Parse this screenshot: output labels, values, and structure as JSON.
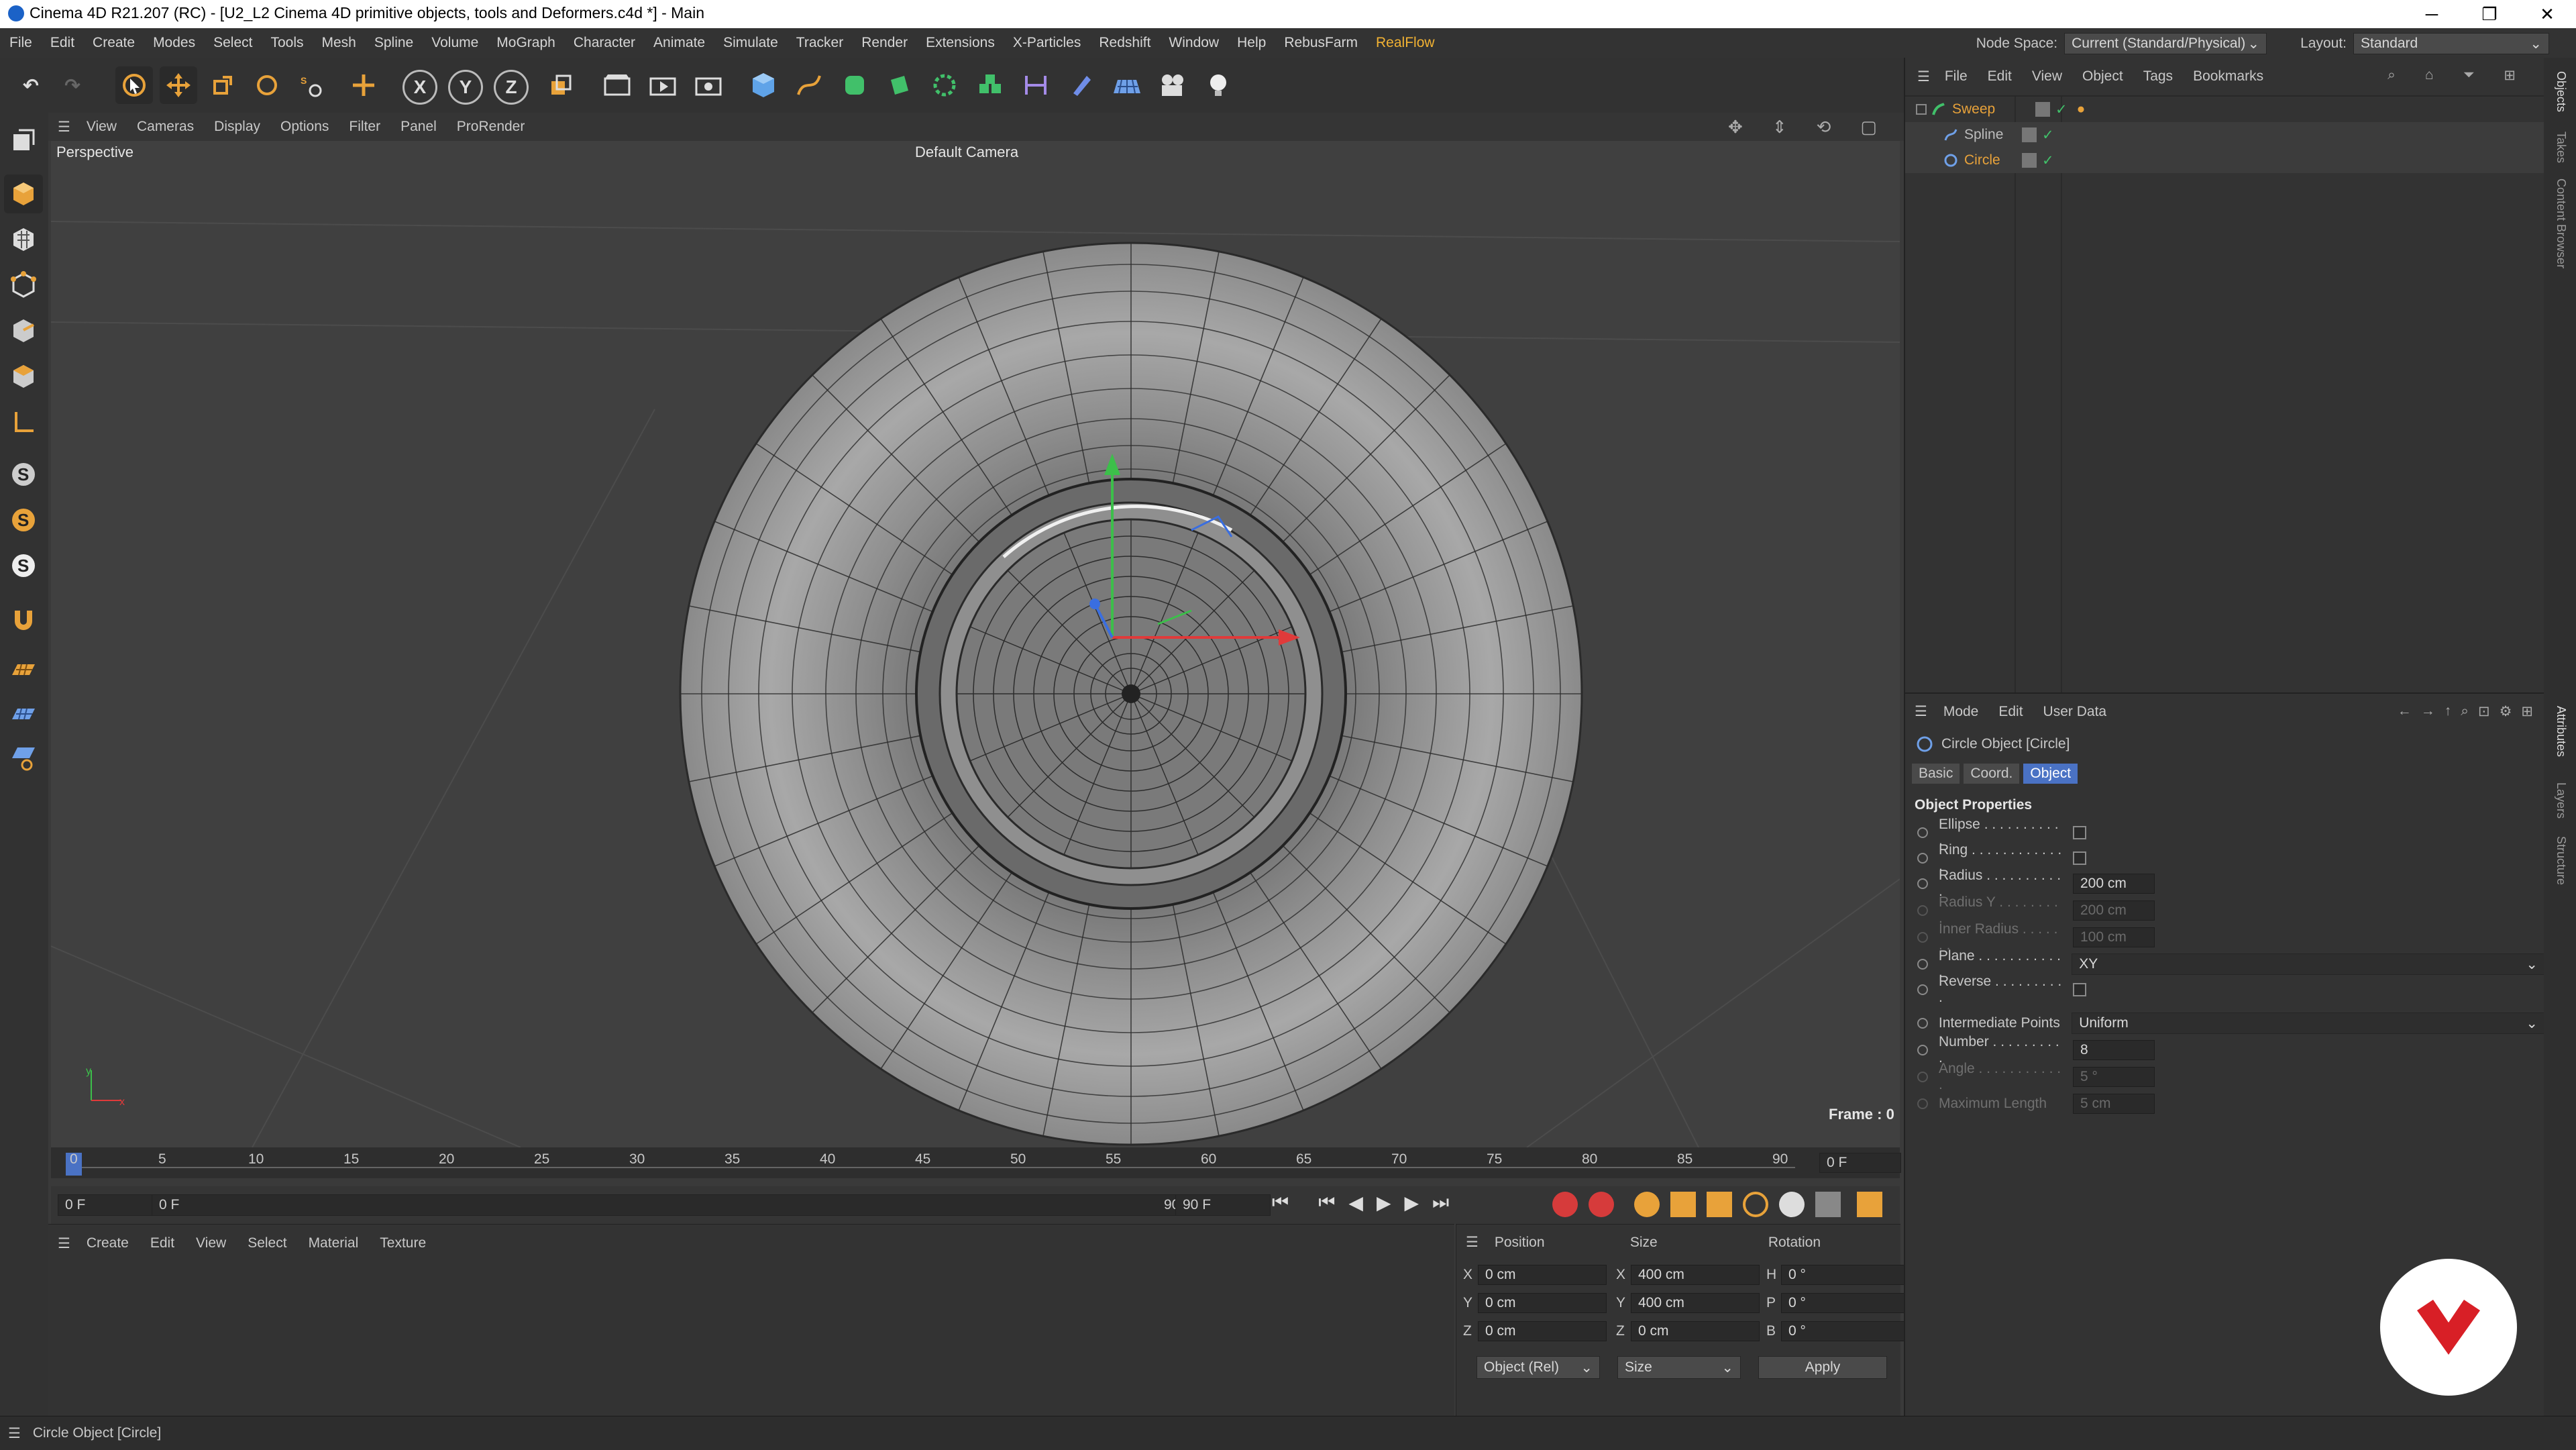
{
  "window": {
    "title": "Cinema 4D R21.207 (RC) - [U2_L2 Cinema 4D primitive objects, tools and  Deformers.c4d *] - Main",
    "minimize": "─",
    "restore": "❐",
    "close": "✕"
  },
  "menubar": {
    "items": [
      "File",
      "Edit",
      "Create",
      "Modes",
      "Select",
      "Tools",
      "Mesh",
      "Spline",
      "Volume",
      "MoGraph",
      "Character",
      "Animate",
      "Simulate",
      "Tracker",
      "Render",
      "Extensions",
      "X-Particles",
      "Redshift",
      "Window",
      "Help",
      "RebusFarm",
      "RealFlow"
    ],
    "node_space_label": "Node Space:",
    "node_space_value": "Current (Standard/Physical)",
    "layout_label": "Layout:",
    "layout_value": "Standard"
  },
  "toolbar": {
    "axis_x": "X",
    "axis_y": "Y",
    "axis_z": "Z"
  },
  "viewport": {
    "menu": [
      "View",
      "Cameras",
      "Display",
      "Options",
      "Filter",
      "Panel",
      "ProRender"
    ],
    "view_name": "Perspective",
    "camera": "Default Camera",
    "frame_label": "Frame : 0",
    "axis_x": "x",
    "axis_y": "y"
  },
  "timeline": {
    "ticks": [
      "0",
      "5",
      "10",
      "15",
      "20",
      "25",
      "30",
      "35",
      "40",
      "45",
      "50",
      "55",
      "60",
      "65",
      "70",
      "75",
      "80",
      "85",
      "90"
    ],
    "current_frame": "0 F",
    "start_field": "0 F",
    "range_start": "0 F",
    "range_end": "90 F",
    "end_field": "90 F"
  },
  "material_manager": {
    "menu": [
      "Create",
      "Edit",
      "View",
      "Select",
      "Material",
      "Texture"
    ]
  },
  "coordinates": {
    "headers": [
      "Position",
      "Size",
      "Rotation"
    ],
    "rows": [
      {
        "axis": "X",
        "pos": "0 cm",
        "size_axis": "X",
        "size": "400 cm",
        "rot_axis": "H",
        "rot": "0 °"
      },
      {
        "axis": "Y",
        "pos": "0 cm",
        "size_axis": "Y",
        "size": "400 cm",
        "rot_axis": "P",
        "rot": "0 °"
      },
      {
        "axis": "Z",
        "pos": "0 cm",
        "size_axis": "Z",
        "size": "0 cm",
        "rot_axis": "B",
        "rot": "0 °"
      }
    ],
    "mode_dropdown": "Object (Rel)",
    "size_dropdown": "Size",
    "apply": "Apply"
  },
  "object_manager": {
    "menu": [
      "File",
      "Edit",
      "View",
      "Object",
      "Tags",
      "Bookmarks"
    ],
    "objects": [
      {
        "name": "Sweep",
        "indent": 0
      },
      {
        "name": "Spline",
        "indent": 1
      },
      {
        "name": "Circle",
        "indent": 1
      }
    ]
  },
  "attribute_manager": {
    "menu": [
      "Mode",
      "Edit",
      "User Data"
    ],
    "object_title": "Circle Object [Circle]",
    "tabs": [
      "Basic",
      "Coord.",
      "Object"
    ],
    "section_title": "Object Properties",
    "properties": [
      {
        "label": "Ellipse . . . . . . . . . . .",
        "type": "check"
      },
      {
        "label": "Ring . . . . . . . . . . . . .",
        "type": "check"
      },
      {
        "label": "Radius . . . . . . . . . . .",
        "type": "num",
        "value": "200 cm"
      },
      {
        "label": "Radius Y . . . . . . . . .",
        "type": "num",
        "value": "200 cm",
        "dim": true
      },
      {
        "label": "Inner Radius . . . . . . .",
        "type": "num",
        "value": "100 cm",
        "dim": true
      },
      {
        "label": "Plane . . . . . . . . . . . .",
        "type": "select",
        "value": "XY"
      },
      {
        "label": "Reverse . . . . . . . . . .",
        "type": "check"
      },
      {
        "label": "Intermediate Points",
        "type": "select",
        "value": "Uniform"
      },
      {
        "label": "Number . . . . . . . . . .",
        "type": "num",
        "value": "8"
      },
      {
        "label": "Angle . . . . . . . . . . . .",
        "type": "num",
        "value": "5 °",
        "dim": true
      },
      {
        "label": "Maximum Length",
        "type": "num",
        "value": "5 cm",
        "dim": true
      }
    ]
  },
  "side_tabs": [
    "Objects",
    "Takes",
    "Content Browser",
    "Attributes",
    "Layers",
    "Structure"
  ],
  "status": {
    "text": "Circle Object [Circle]"
  }
}
